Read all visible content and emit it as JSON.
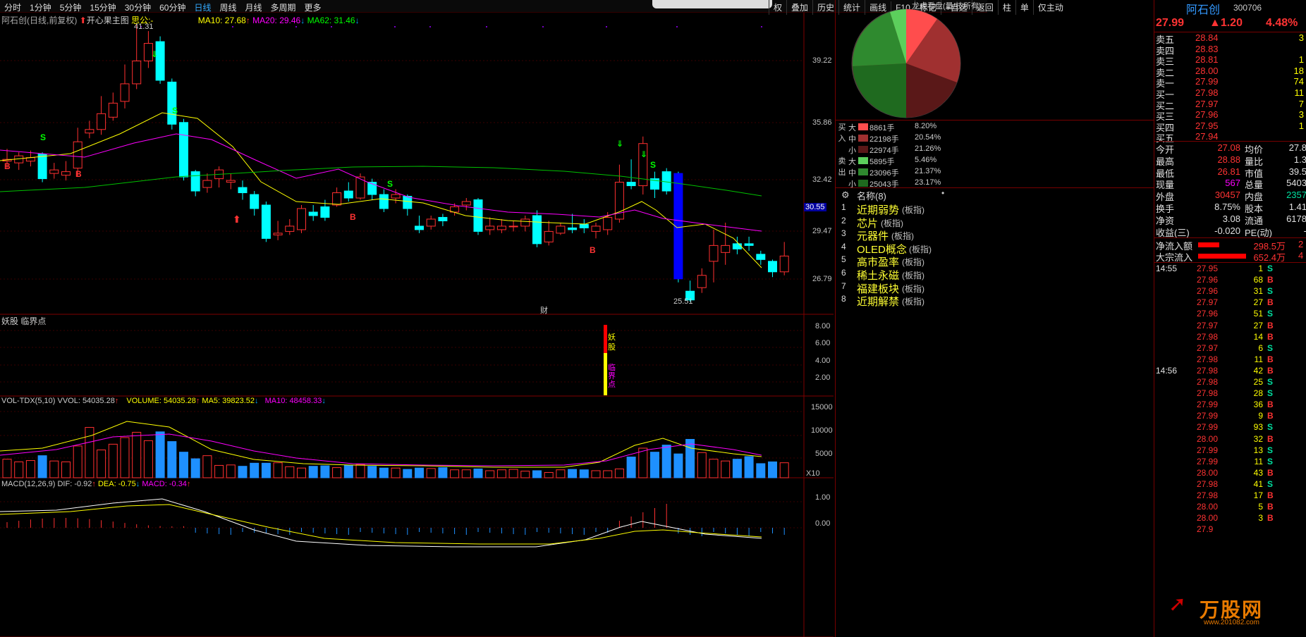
{
  "periods": [
    "分时",
    "1分钟",
    "5分钟",
    "15分钟",
    "30分钟",
    "60分钟",
    "日线",
    "周线",
    "月线",
    "多周期",
    "更多"
  ],
  "periods_selected": "日线",
  "toolbar": [
    "权",
    "叠加",
    "历史",
    "统计",
    "画线",
    "F10",
    "标记",
    "+自选",
    "返回",
    "柱",
    "单",
    "仅主动"
  ],
  "chart_header": {
    "stock": "阿石创(日线,前复权)",
    "indicator": "开心果主图",
    "extra": "思公:-",
    "ma10": "MA10: 27.68",
    "ma20": "MA20: 29.46",
    "ma62": "MA62: 31.46"
  },
  "price_axis": [
    "39.22",
    "35.86",
    "32.42",
    "29.47",
    "26.79"
  ],
  "price_marker": "30.55",
  "high_label": "41.31",
  "low_label": "25.51",
  "fin_marker": "财",
  "panel2": {
    "title": "妖股 临界点",
    "ticks": [
      "8.00",
      "6.00",
      "4.00",
      "2.00"
    ],
    "bar_text1": "妖股",
    "bar_text2": "临界点"
  },
  "vol_header": {
    "name": "VOL-TDX(5,10)",
    "vvol": "VVOL: 54035.28",
    "volume": "VOLUME: 54035.28",
    "ma5": "MA5: 39823.52",
    "ma10": "MA10: 48458.33"
  },
  "vol_ticks": [
    "15000",
    "10000",
    "5000"
  ],
  "vol_unit": "X10",
  "macd_header": {
    "name": "MACD(12,26,9)",
    "dif": "DIF: -0.92",
    "dea": "DEA: -0.75",
    "macd": "MACD: -0.34"
  },
  "macd_ticks": [
    "1.00",
    "0.00"
  ],
  "capital_header": "龙虎看盘(量/技所有)",
  "flow_buy": [
    {
      "k": "大",
      "v": "8861手",
      "p": "8.20%"
    },
    {
      "k": "中",
      "v": "22198手",
      "p": "20.54%"
    },
    {
      "k": "小",
      "v": "22974手",
      "p": "21.26%"
    }
  ],
  "flow_sell": [
    {
      "k": "大",
      "v": "5895手",
      "p": "5.46%"
    },
    {
      "k": "中",
      "v": "23096手",
      "p": "21.37%"
    },
    {
      "k": "小",
      "v": "25043手",
      "p": "23.17%"
    }
  ],
  "flow_side": {
    "buy": "买入",
    "sell": "卖出"
  },
  "concepts_header": "名称(8)",
  "concepts": [
    {
      "n": "1",
      "name": "近期弱势",
      "tag": "(板指)"
    },
    {
      "n": "2",
      "name": "芯片",
      "tag": "(板指)"
    },
    {
      "n": "3",
      "name": "元器件",
      "tag": "(板指)"
    },
    {
      "n": "4",
      "name": "OLED概念",
      "tag": "(板指)"
    },
    {
      "n": "5",
      "name": "高市盈率",
      "tag": "(板指)"
    },
    {
      "n": "6",
      "name": "稀土永磁",
      "tag": "(板指)"
    },
    {
      "n": "7",
      "name": "福建板块",
      "tag": "(板指)"
    },
    {
      "n": "8",
      "name": "近期解禁",
      "tag": "(板指)"
    }
  ],
  "quote": {
    "name": "阿石创",
    "code": "300706",
    "price": "27.99",
    "change": "▲1.20",
    "pct": "4.48%"
  },
  "asks": [
    {
      "l": "卖五",
      "p": "28.84",
      "v": "3"
    },
    {
      "l": "卖四",
      "p": "28.83",
      "v": ""
    },
    {
      "l": "卖三",
      "p": "28.81",
      "v": "1"
    },
    {
      "l": "卖二",
      "p": "28.00",
      "v": "18"
    },
    {
      "l": "卖一",
      "p": "27.99",
      "v": "74"
    }
  ],
  "bids": [
    {
      "l": "买一",
      "p": "27.98",
      "v": "11"
    },
    {
      "l": "买二",
      "p": "27.97",
      "v": "7"
    },
    {
      "l": "买三",
      "p": "27.96",
      "v": "3"
    },
    {
      "l": "买四",
      "p": "27.95",
      "v": "1"
    },
    {
      "l": "买五",
      "p": "27.94",
      "v": ""
    }
  ],
  "stats": [
    {
      "a": "今开",
      "b": "27.08",
      "c": "均价",
      "d": "27.8"
    },
    {
      "a": "最高",
      "b": "28.88",
      "c": "量比",
      "d": "1.3"
    },
    {
      "a": "最低",
      "b": "26.81",
      "c": "市值",
      "d": "39.5"
    },
    {
      "a": "现量",
      "b": "567",
      "c": "总量",
      "d": "5403"
    },
    {
      "a": "外盘",
      "b": "30457",
      "c": "内盘",
      "d": "2357"
    },
    {
      "a": "换手",
      "b": "8.75%",
      "c": "股本",
      "d": "1.41"
    },
    {
      "a": "净资",
      "b": "3.08",
      "c": "流通",
      "d": "6178"
    },
    {
      "a": "收益(三)",
      "b": "-0.020",
      "c": "PE(动)",
      "d": "-"
    }
  ],
  "netflow": [
    {
      "l": "净流入额",
      "v": "298.5万",
      "x": "2"
    },
    {
      "l": "大宗流入",
      "v": "652.4万",
      "x": "4"
    }
  ],
  "ticks": [
    {
      "t": "14:55",
      "p": "27.95",
      "v": "1",
      "s": "S"
    },
    {
      "t": "",
      "p": "27.96",
      "v": "68",
      "s": "B"
    },
    {
      "t": "",
      "p": "27.96",
      "v": "31",
      "s": "S"
    },
    {
      "t": "",
      "p": "27.97",
      "v": "27",
      "s": "B"
    },
    {
      "t": "",
      "p": "27.96",
      "v": "51",
      "s": "S"
    },
    {
      "t": "",
      "p": "27.97",
      "v": "27",
      "s": "B"
    },
    {
      "t": "",
      "p": "27.98",
      "v": "14",
      "s": "B"
    },
    {
      "t": "",
      "p": "27.97",
      "v": "6",
      "s": "S"
    },
    {
      "t": "",
      "p": "27.98",
      "v": "11",
      "s": "B"
    },
    {
      "t": "14:56",
      "p": "27.98",
      "v": "42",
      "s": "B"
    },
    {
      "t": "",
      "p": "27.98",
      "v": "25",
      "s": "S"
    },
    {
      "t": "",
      "p": "27.98",
      "v": "28",
      "s": "S"
    },
    {
      "t": "",
      "p": "27.99",
      "v": "36",
      "s": "B"
    },
    {
      "t": "",
      "p": "27.99",
      "v": "9",
      "s": "B"
    },
    {
      "t": "",
      "p": "27.99",
      "v": "93",
      "s": "S"
    },
    {
      "t": "",
      "p": "28.00",
      "v": "32",
      "s": "B"
    },
    {
      "t": "",
      "p": "27.99",
      "v": "13",
      "s": "S"
    },
    {
      "t": "",
      "p": "27.99",
      "v": "11",
      "s": "S"
    },
    {
      "t": "",
      "p": "28.00",
      "v": "43",
      "s": "B"
    },
    {
      "t": "",
      "p": "27.98",
      "v": "41",
      "s": "S"
    },
    {
      "t": "",
      "p": "27.98",
      "v": "17",
      "s": "B"
    },
    {
      "t": "",
      "p": "28.00",
      "v": "5",
      "s": "B"
    },
    {
      "t": "",
      "p": "28.00",
      "v": "3",
      "s": "B"
    },
    {
      "t": "",
      "p": "27.9",
      "v": "",
      "s": ""
    }
  ],
  "watermark": "万股网",
  "watermark_url": "www.201082.com",
  "colors": {
    "up": "#ff3030",
    "down": "#00ffff",
    "ma10": "#ffff00",
    "ma20": "#ff00ff",
    "ma62": "#00c000",
    "grid": "#3a0000"
  }
}
